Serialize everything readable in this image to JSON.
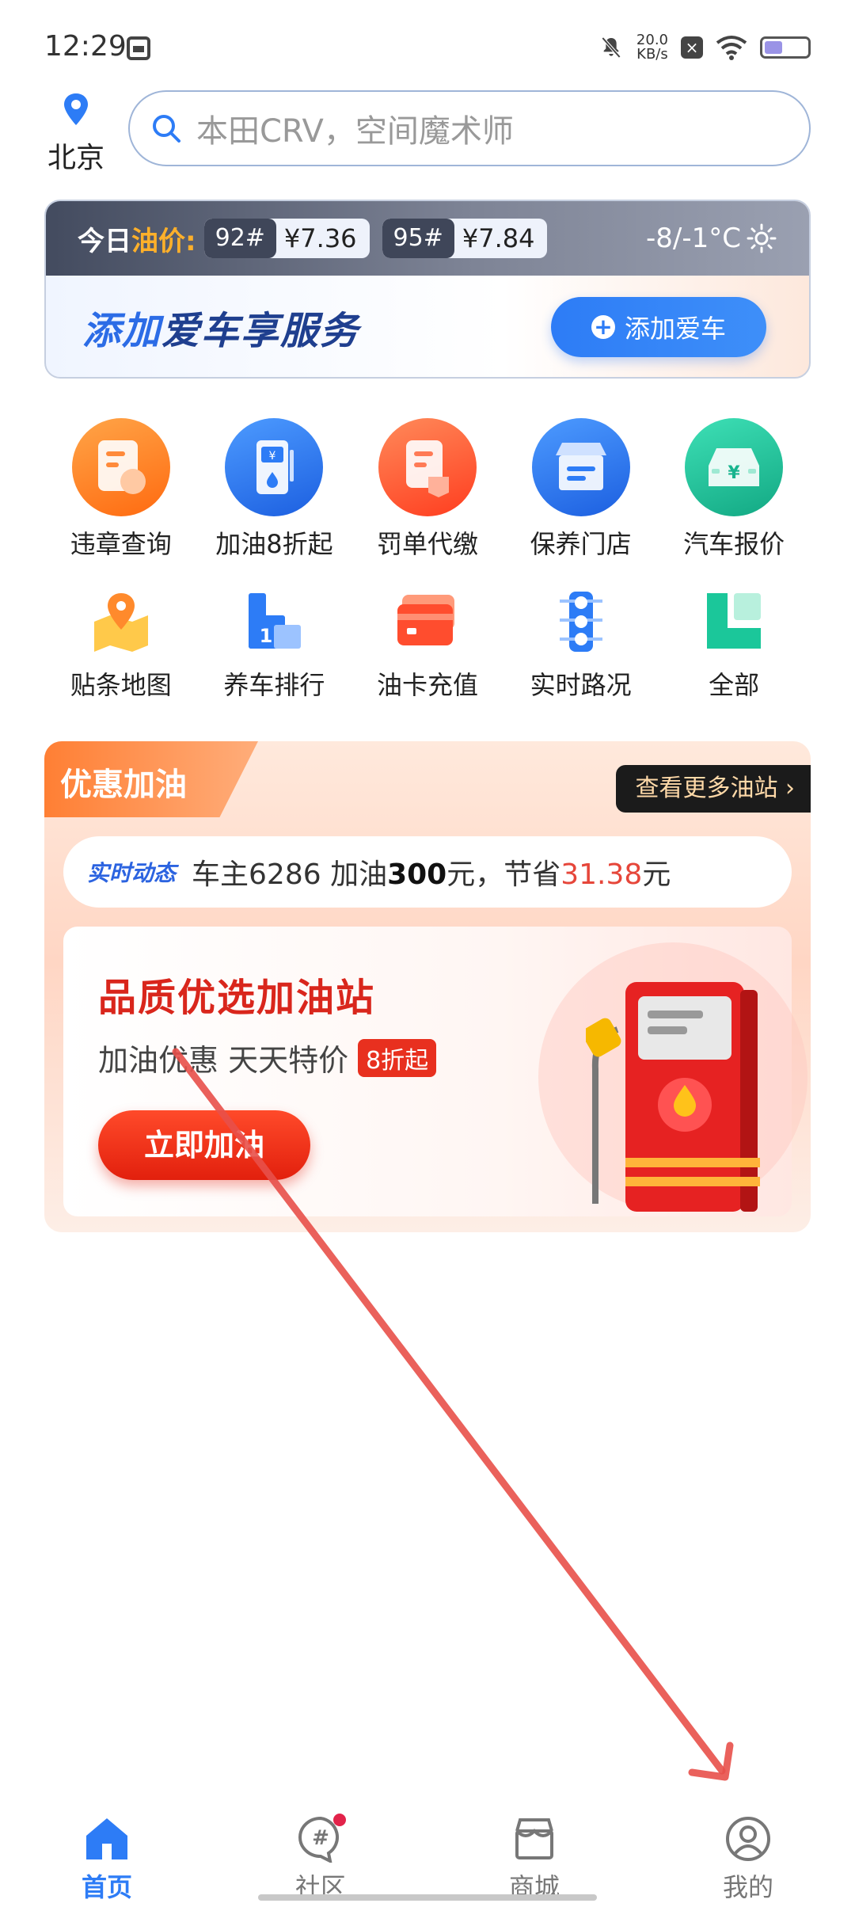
{
  "status_bar": {
    "time": "12:29",
    "speed_value": "20.0",
    "speed_unit": "KB/s"
  },
  "header": {
    "city": "北京",
    "search_placeholder": "本田CRV，空间魔术师"
  },
  "oil": {
    "title_prefix": "今日",
    "title_highlight": "油价:",
    "prices": [
      {
        "grade": "92#",
        "price": "¥7.36"
      },
      {
        "grade": "95#",
        "price": "¥7.84"
      }
    ],
    "weather": "-8/-1°C",
    "add_service_title_a": "添加",
    "add_service_title_b": "爱车享服务",
    "add_car_button": "添加爱车"
  },
  "shortcuts": {
    "row1": [
      {
        "label": "违章查询",
        "icon": "violation-icon",
        "color": "#ff7a1a"
      },
      {
        "label": "加油8折起",
        "icon": "fuel-discount-icon",
        "color": "#2d7cf6"
      },
      {
        "label": "罚单代缴",
        "icon": "fine-pay-icon",
        "color": "#ff5a2c"
      },
      {
        "label": "保养门店",
        "icon": "maintenance-store-icon",
        "color": "#2d7cf6"
      },
      {
        "label": "汽车报价",
        "icon": "car-price-icon",
        "color": "#1bbf9a"
      }
    ],
    "row2": [
      {
        "label": "贴条地图",
        "icon": "ticket-map-icon",
        "color": "#ff9a2c"
      },
      {
        "label": "养车排行",
        "icon": "ranking-icon",
        "color": "#2d7cf6"
      },
      {
        "label": "油卡充值",
        "icon": "fuel-card-icon",
        "color": "#ff5a3c"
      },
      {
        "label": "实时路况",
        "icon": "traffic-light-icon",
        "color": "#2d7cf6"
      },
      {
        "label": "全部",
        "icon": "all-apps-icon",
        "color": "#1bc79a"
      }
    ]
  },
  "promo": {
    "tab_label": "优惠加油",
    "more_button": "查看更多油站 ›",
    "live_tag": "实时动态",
    "live_text_a": "车主6286 加油",
    "live_amount": "300",
    "live_text_b": "元，节省",
    "live_saved": "31.38",
    "live_text_c": "元",
    "card_title": "品质优选加油站",
    "card_subtitle": "加油优惠 天天特价",
    "card_badge": "8折起",
    "card_button": "立即加油"
  },
  "bottom_nav": {
    "items": [
      {
        "label": "首页",
        "icon": "home-icon",
        "active": true
      },
      {
        "label": "社区",
        "icon": "community-icon",
        "active": false
      },
      {
        "label": "商城",
        "icon": "store-icon",
        "active": false
      },
      {
        "label": "我的",
        "icon": "profile-icon",
        "active": false
      }
    ]
  },
  "colors": {
    "brand_blue": "#2d7cf6",
    "promo_red": "#d9261c",
    "annotation_arrow": "#e8504a"
  }
}
